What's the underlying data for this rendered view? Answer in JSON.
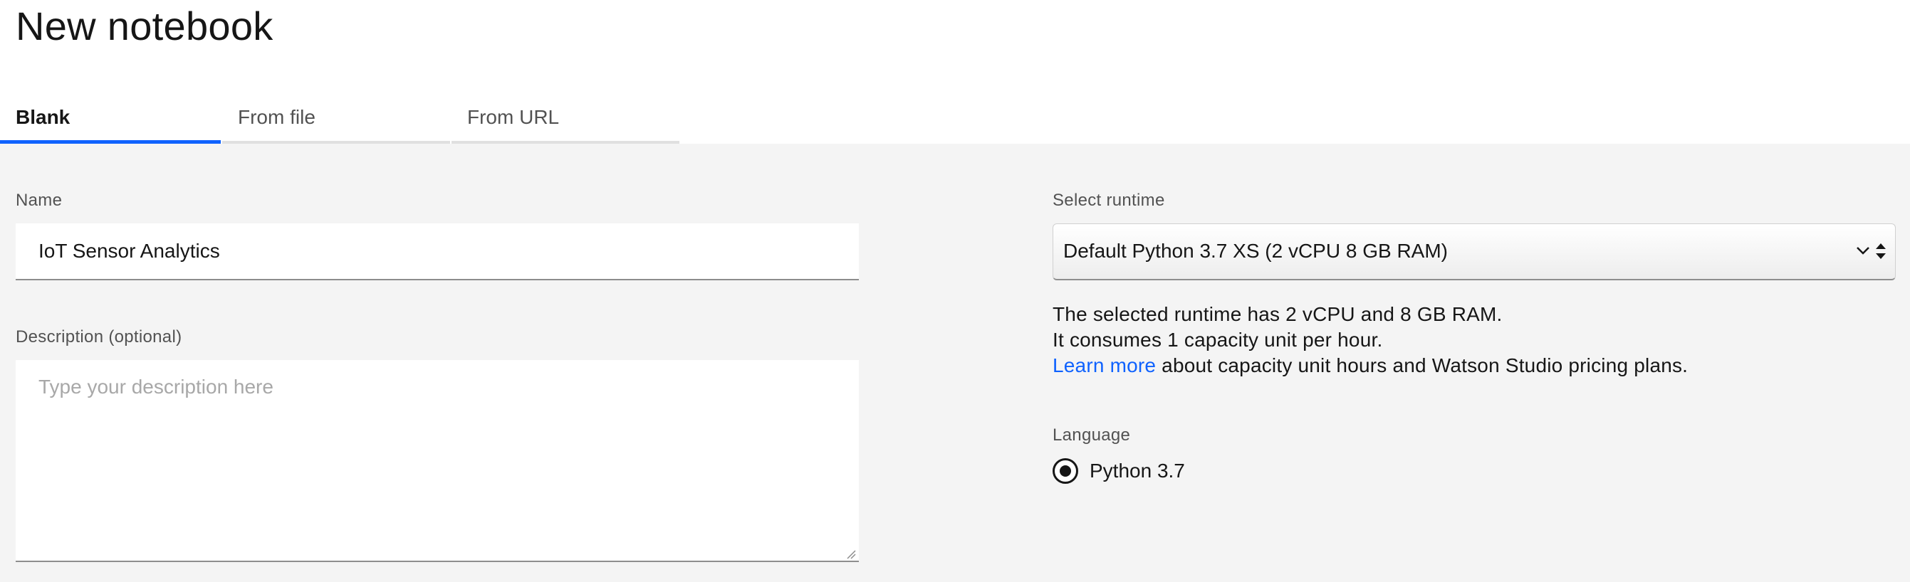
{
  "page": {
    "title": "New notebook"
  },
  "tabs": [
    {
      "label": "Blank",
      "active": true
    },
    {
      "label": "From file",
      "active": false
    },
    {
      "label": "From URL",
      "active": false
    }
  ],
  "form": {
    "name": {
      "label": "Name",
      "value": "IoT Sensor Analytics"
    },
    "description": {
      "label": "Description (optional)",
      "placeholder": "Type your description here",
      "value": ""
    },
    "runtime": {
      "label": "Select runtime",
      "selected": "Default Python 3.7 XS (2 vCPU 8 GB RAM)",
      "info_line1": "The selected runtime has 2 vCPU and 8 GB RAM.",
      "info_line2": "It consumes 1 capacity unit per hour.",
      "learn_more_link": "Learn more",
      "learn_more_suffix": " about capacity unit hours and Watson Studio pricing plans."
    },
    "language": {
      "label": "Language",
      "option": "Python 3.7",
      "selected": true
    }
  },
  "colors": {
    "accent": "#0f62fe",
    "background": "#f4f4f4",
    "text": "#161616",
    "muted": "#525252",
    "placeholder": "#a8a8a8"
  },
  "icons": {
    "select_arrows": "chevron-down-updown-icon",
    "radio": "radio-selected-icon",
    "resize": "resize-handle-icon"
  }
}
